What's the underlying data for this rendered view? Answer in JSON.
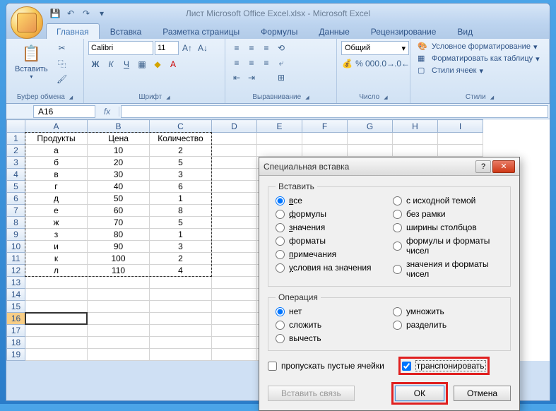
{
  "window": {
    "title": "Лист Microsoft Office Excel.xlsx - Microsoft Excel"
  },
  "tabs": {
    "home": "Главная",
    "insert": "Вставка",
    "page_layout": "Разметка страницы",
    "formulas": "Формулы",
    "data": "Данные",
    "review": "Рецензирование",
    "view": "Вид"
  },
  "ribbon": {
    "clipboard": {
      "label": "Буфер обмена",
      "paste": "Вставить"
    },
    "font": {
      "label": "Шрифт",
      "name": "Calibri",
      "size": "11"
    },
    "alignment": {
      "label": "Выравнивание"
    },
    "number": {
      "label": "Число",
      "format": "Общий"
    },
    "styles": {
      "label": "Стили",
      "conditional": "Условное форматирование",
      "format_as_table": "Форматировать как таблицу",
      "cell_styles": "Стили ячеек"
    }
  },
  "namebox": "A16",
  "grid": {
    "columns": [
      "A",
      "B",
      "C",
      "D",
      "E",
      "F",
      "G",
      "H",
      "I"
    ],
    "headers": [
      "Продукты",
      "Цена",
      "Количество"
    ],
    "rows": [
      {
        "p": "а",
        "c": "10",
        "q": "2"
      },
      {
        "p": "б",
        "c": "20",
        "q": "5"
      },
      {
        "p": "в",
        "c": "30",
        "q": "3"
      },
      {
        "p": "г",
        "c": "40",
        "q": "6"
      },
      {
        "p": "д",
        "c": "50",
        "q": "1"
      },
      {
        "p": "е",
        "c": "60",
        "q": "8"
      },
      {
        "p": "ж",
        "c": "70",
        "q": "5"
      },
      {
        "p": "з",
        "c": "80",
        "q": "1"
      },
      {
        "p": "и",
        "c": "90",
        "q": "3"
      },
      {
        "p": "к",
        "c": "100",
        "q": "2"
      },
      {
        "p": "л",
        "c": "110",
        "q": "4"
      }
    ]
  },
  "dialog": {
    "title": "Специальная вставка",
    "paste_group": "Вставить",
    "paste_options_left": [
      {
        "label": "все",
        "u": "в",
        "checked": true
      },
      {
        "label": "формулы",
        "u": "ф"
      },
      {
        "label": "значения",
        "u": "з"
      },
      {
        "label": "форматы",
        "u": ""
      },
      {
        "label": "примечания",
        "u": "п"
      },
      {
        "label": "условия на значения",
        "u": "у"
      }
    ],
    "paste_options_right": [
      {
        "label": "с исходной темой"
      },
      {
        "label": "без рамки"
      },
      {
        "label": "ширины столбцов"
      },
      {
        "label": "формулы и форматы чисел"
      },
      {
        "label": "значения и форматы чисел"
      }
    ],
    "operation_group": "Операция",
    "op_left": [
      {
        "label": "нет",
        "checked": true
      },
      {
        "label": "сложить"
      },
      {
        "label": "вычесть"
      }
    ],
    "op_right": [
      {
        "label": "умножить"
      },
      {
        "label": "разделить"
      }
    ],
    "skip_blanks": "пропускать пустые ячейки",
    "transpose": "транспонировать",
    "paste_link": "Вставить связь",
    "ok": "ОК",
    "cancel": "Отмена"
  }
}
